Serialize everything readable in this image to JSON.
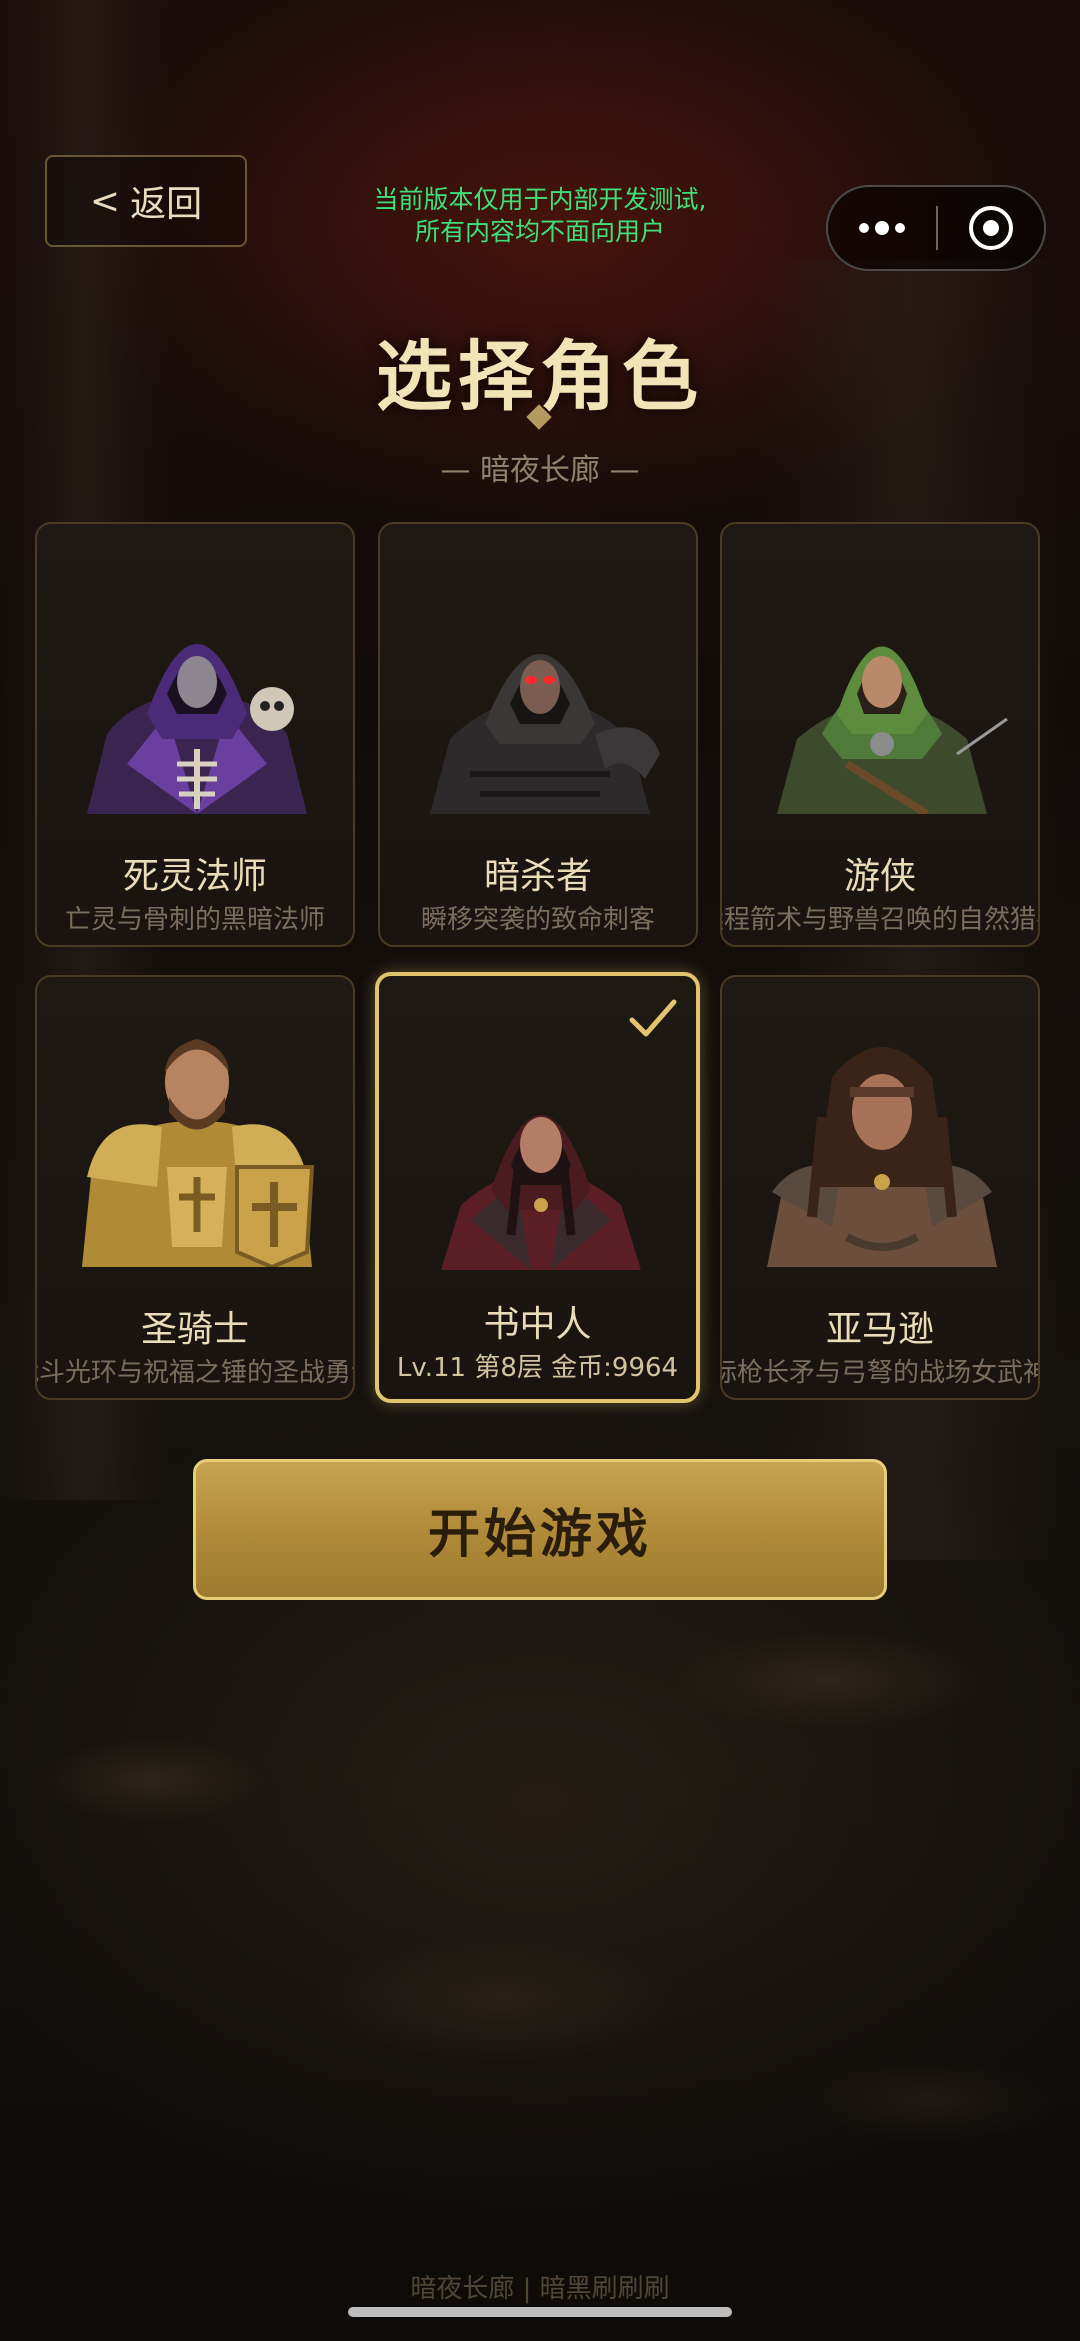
{
  "header": {
    "back_label": "返回",
    "notice_line1": "当前版本仅用于内部开发测试,",
    "notice_line2": "所有内容均不面向用户"
  },
  "title": "选择角色",
  "subtitle": "— 暗夜长廊 —",
  "characters": [
    {
      "name": "死灵法师",
      "desc": "亡灵与骨刺的黑暗法师",
      "icon": "necromancer-portrait",
      "selected": false
    },
    {
      "name": "暗杀者",
      "desc": "瞬移突袭的致命刺客",
      "icon": "assassin-portrait",
      "selected": false
    },
    {
      "name": "游侠",
      "desc": "远程箭术与野兽召唤的自然猎手",
      "icon": "ranger-portrait",
      "selected": false
    },
    {
      "name": "圣骑士",
      "desc": "战斗光环与祝福之锤的圣战勇士",
      "icon": "paladin-portrait",
      "selected": false
    },
    {
      "name": "书中人",
      "desc": "Lv.11 第8层 金币:9964",
      "icon": "sorceress-portrait",
      "selected": true
    },
    {
      "name": "亚马逊",
      "desc": "标枪长矛与弓弩的战场女武神",
      "icon": "amazon-portrait",
      "selected": false
    }
  ],
  "start_label": "开始游戏",
  "footer": "暗夜长廊 | 暗黑刷刷刷",
  "colors": {
    "accent_gold": "#e3c46e",
    "notice_green": "#3fe07a",
    "button_gold": "#b38d3b"
  }
}
